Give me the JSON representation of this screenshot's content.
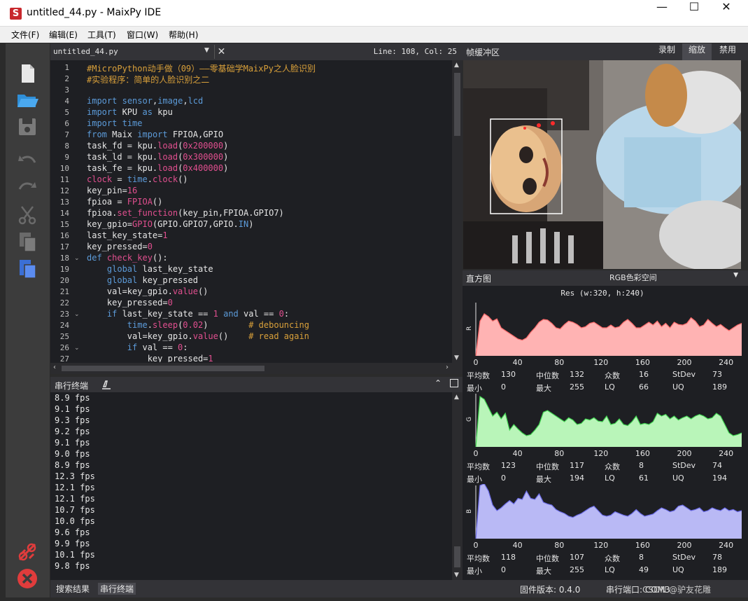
{
  "window": {
    "icon_letter": "S",
    "title": "untitled_44.py - MaixPy IDE",
    "minimize": "—",
    "maximize": "☐",
    "close": "✕"
  },
  "menu": [
    "文件(F)",
    "编辑(E)",
    "工具(T)",
    "窗口(W)",
    "帮助(H)"
  ],
  "sidebar": {
    "icons": [
      "new-file-icon",
      "open-folder-icon",
      "save-icon",
      "undo-icon",
      "redo-icon",
      "cut-icon",
      "copy-icon",
      "paste-icon",
      "disconnect-icon",
      "stop-icon"
    ]
  },
  "editor": {
    "filename": "untitled_44.py",
    "position": "Line: 108, Col: 25",
    "lines": [
      {
        "n": "1",
        "fold": "",
        "html": "<span class='c-com'>#MicroPython动手做（09）——零基础学MaixPy之人脸识别</span>"
      },
      {
        "n": "2",
        "fold": "",
        "html": "<span class='c-com'>#实验程序：简单的人脸识别之二</span>"
      },
      {
        "n": "3",
        "fold": "",
        "html": ""
      },
      {
        "n": "4",
        "fold": "",
        "html": "<span class='c-kw'>import</span> <span class='c-kw'>sensor</span>,<span class='c-kw'>image</span>,<span class='c-kw'>lcd</span>"
      },
      {
        "n": "5",
        "fold": "",
        "html": "<span class='c-kw'>import</span> KPU <span class='c-kw'>as</span> kpu"
      },
      {
        "n": "6",
        "fold": "",
        "html": "<span class='c-kw'>import</span> <span class='c-kw'>time</span>"
      },
      {
        "n": "7",
        "fold": "",
        "html": "<span class='c-kw'>from</span> Maix <span class='c-kw'>import</span> FPIOA,GPIO"
      },
      {
        "n": "8",
        "fold": "",
        "html": "task_fd = kpu.<span class='c-fn'>load</span>(<span class='c-num'>0x200000</span>)"
      },
      {
        "n": "9",
        "fold": "",
        "html": "task_ld = kpu.<span class='c-fn'>load</span>(<span class='c-num'>0x300000</span>)"
      },
      {
        "n": "10",
        "fold": "",
        "html": "task_fe = kpu.<span class='c-fn'>load</span>(<span class='c-num'>0x400000</span>)"
      },
      {
        "n": "11",
        "fold": "",
        "html": "<span class='c-fn'>clock</span> = <span class='c-kw'>time</span>.<span class='c-fn'>clock</span>()"
      },
      {
        "n": "12",
        "fold": "",
        "html": "key_pin=<span class='c-num'>16</span>"
      },
      {
        "n": "13",
        "fold": "",
        "html": "fpioa = <span class='c-fn'>FPIOA</span>()"
      },
      {
        "n": "14",
        "fold": "",
        "html": "fpioa.<span class='c-fn'>set_function</span>(key_pin,FPIOA.GPIO7)"
      },
      {
        "n": "15",
        "fold": "",
        "html": "key_gpio=<span class='c-fn'>GPIO</span>(GPIO.GPIO7,GPIO.<span class='c-kw'>IN</span>)"
      },
      {
        "n": "16",
        "fold": "",
        "html": "last_key_state=<span class='c-num'>1</span>"
      },
      {
        "n": "17",
        "fold": "",
        "html": "key_pressed=<span class='c-num'>0</span>"
      },
      {
        "n": "18",
        "fold": "⌄",
        "html": "<span class='c-kw'>def</span> <span class='c-fn'>check_key</span>():"
      },
      {
        "n": "19",
        "fold": "",
        "html": "    <span class='c-kw'>global</span> last_key_state"
      },
      {
        "n": "20",
        "fold": "",
        "html": "    <span class='c-kw'>global</span> key_pressed"
      },
      {
        "n": "21",
        "fold": "",
        "html": "    val=key_gpio.<span class='c-fn'>value</span>()"
      },
      {
        "n": "22",
        "fold": "",
        "html": "    key_pressed=<span class='c-num'>0</span>"
      },
      {
        "n": "23",
        "fold": "⌄",
        "html": "    <span class='c-kw'>if</span> last_key_state == <span class='c-num'>1</span> <span class='c-kw'>and</span> val == <span class='c-num'>0</span>:"
      },
      {
        "n": "24",
        "fold": "",
        "html": "        <span class='c-kw'>time</span>.<span class='c-fn'>sleep</span>(<span class='c-num'>0.02</span>)        <span class='c-com'># debouncing</span>"
      },
      {
        "n": "25",
        "fold": "",
        "html": "        val=key_gpio.<span class='c-fn'>value</span>()    <span class='c-com'># read again</span>"
      },
      {
        "n": "26",
        "fold": "⌄",
        "html": "        <span class='c-kw'>if</span> val == <span class='c-num'>0</span>:"
      },
      {
        "n": "27",
        "fold": "",
        "html": "            key_pressed=<span class='c-num'>1</span>"
      }
    ]
  },
  "terminal": {
    "title": "串行终端",
    "lines": [
      "8.9 fps",
      "9.1 fps",
      "9.3 fps",
      "9.2 fps",
      "9.1 fps",
      "9.0 fps",
      "8.9 fps",
      "12.3 fps",
      "12.1 fps",
      "12.1 fps",
      "10.7 fps",
      "10.0 fps",
      "9.6 fps",
      "9.9 fps",
      "10.1 fps",
      "9.8 fps"
    ]
  },
  "bottom": {
    "tabs": [
      "搜索结果",
      "串行终端"
    ],
    "firmware": "固件版本: 0.4.0",
    "serial": "串行端口: COM3",
    "watermark": "CSDN @驴友花雕"
  },
  "framebuffer": {
    "title": "帧缓冲区",
    "buttons": [
      "录制",
      "缩放",
      "禁用"
    ]
  },
  "histogram": {
    "title": "直方图",
    "colorspace": "RGB色彩空间",
    "resolution": "Res (w:320, h:240)",
    "x_ticks": [
      "0",
      "40",
      "80",
      "120",
      "160",
      "200",
      "240"
    ],
    "stat_labels": {
      "mean": "平均数",
      "median": "中位数",
      "mode": "众数",
      "stdev": "StDev",
      "min": "最小",
      "max": "最大",
      "lq": "LQ",
      "uq": "UQ"
    },
    "channels": [
      {
        "name": "R",
        "color": "#ffb3b3",
        "stroke": "#ff6a6a",
        "values": [
          0.0,
          0.62,
          0.75,
          0.7,
          0.62,
          0.66,
          0.5,
          0.45,
          0.4,
          0.35,
          0.3,
          0.28,
          0.32,
          0.42,
          0.5,
          0.6,
          0.65,
          0.64,
          0.58,
          0.5,
          0.48,
          0.56,
          0.62,
          0.6,
          0.56,
          0.5,
          0.52,
          0.58,
          0.6,
          0.55,
          0.5,
          0.5,
          0.55,
          0.5,
          0.52,
          0.6,
          0.65,
          0.58,
          0.5,
          0.5,
          0.55,
          0.6,
          0.55,
          0.62,
          0.52,
          0.58,
          0.5,
          0.6,
          0.56,
          0.55,
          0.58,
          0.68,
          0.62,
          0.52,
          0.55,
          0.65,
          0.58,
          0.52,
          0.56,
          0.5,
          0.45,
          0.5,
          0.55,
          0.58
        ],
        "stats": {
          "mean": "130",
          "median": "132",
          "mode": "16",
          "stdev": "73",
          "min": "0",
          "max": "255",
          "lq": "66",
          "uq": "189"
        }
      },
      {
        "name": "G",
        "color": "#b9f5b9",
        "stroke": "#3fd24f",
        "values": [
          0.0,
          0.9,
          0.85,
          0.7,
          0.55,
          0.62,
          0.5,
          0.6,
          0.3,
          0.4,
          0.32,
          0.25,
          0.2,
          0.22,
          0.3,
          0.4,
          0.62,
          0.65,
          0.6,
          0.55,
          0.5,
          0.45,
          0.52,
          0.48,
          0.4,
          0.42,
          0.5,
          0.48,
          0.52,
          0.46,
          0.45,
          0.55,
          0.4,
          0.42,
          0.5,
          0.4,
          0.38,
          0.45,
          0.55,
          0.4,
          0.42,
          0.4,
          0.45,
          0.6,
          0.55,
          0.58,
          0.5,
          0.55,
          0.48,
          0.52,
          0.55,
          0.5,
          0.55,
          0.58,
          0.55,
          0.5,
          0.52,
          0.6,
          0.55,
          0.4,
          0.25,
          0.2,
          0.22,
          0.25
        ],
        "stats": {
          "mean": "123",
          "median": "117",
          "mode": "8",
          "stdev": "74",
          "min": "0",
          "max": "194",
          "lq": "61",
          "uq": "194"
        }
      },
      {
        "name": "B",
        "color": "#b9b9f5",
        "stroke": "#6a6ae6",
        "values": [
          0.0,
          0.95,
          0.98,
          0.85,
          0.6,
          0.5,
          0.55,
          0.62,
          0.68,
          0.62,
          0.72,
          0.7,
          0.85,
          0.72,
          0.7,
          0.8,
          0.65,
          0.62,
          0.6,
          0.52,
          0.48,
          0.45,
          0.4,
          0.38,
          0.42,
          0.45,
          0.5,
          0.55,
          0.58,
          0.5,
          0.42,
          0.4,
          0.42,
          0.48,
          0.45,
          0.42,
          0.4,
          0.45,
          0.52,
          0.45,
          0.4,
          0.42,
          0.44,
          0.5,
          0.55,
          0.52,
          0.48,
          0.5,
          0.58,
          0.6,
          0.55,
          0.5,
          0.52,
          0.55,
          0.48,
          0.5,
          0.55,
          0.52,
          0.5,
          0.55,
          0.5,
          0.52,
          0.48,
          0.5
        ],
        "stats": {
          "mean": "118",
          "median": "107",
          "mode": "8",
          "stdev": "78",
          "min": "0",
          "max": "255",
          "lq": "49",
          "uq": "189"
        }
      }
    ]
  }
}
